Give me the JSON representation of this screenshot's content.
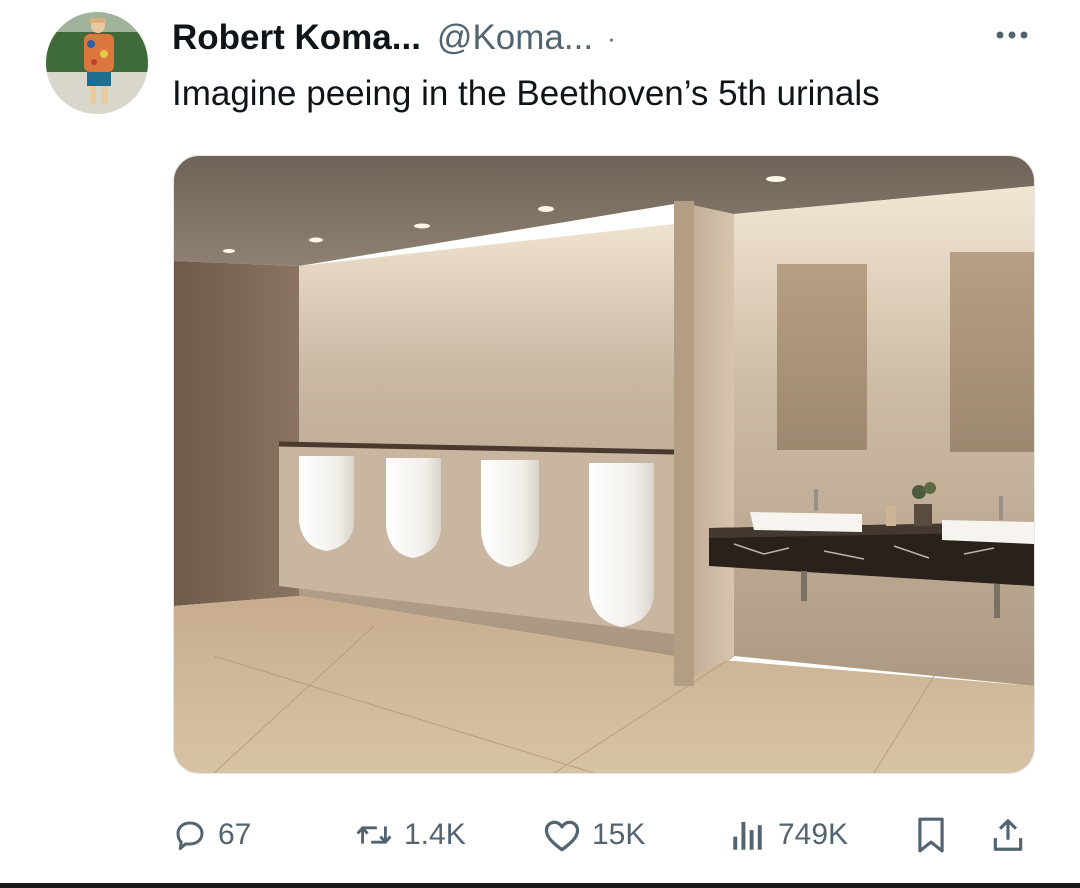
{
  "tweet": {
    "author_name": "Robert Koma...",
    "author_handle": "@Koma...",
    "separator": "·",
    "text": "Imagine peeing in the Beethoven’s 5th urinals"
  },
  "actions": {
    "reply_count": "67",
    "retweet_count": "1.4K",
    "like_count": "15K",
    "view_count": "749K"
  },
  "icons": {
    "more": "more-horizontal-icon",
    "reply": "speech-bubble-icon",
    "retweet": "retweet-arrows-icon",
    "like": "heart-icon",
    "views": "bar-chart-icon",
    "bookmark": "bookmark-icon",
    "share": "share-upload-icon"
  },
  "colors": {
    "text_primary": "#0f1419",
    "text_secondary": "#536471"
  }
}
